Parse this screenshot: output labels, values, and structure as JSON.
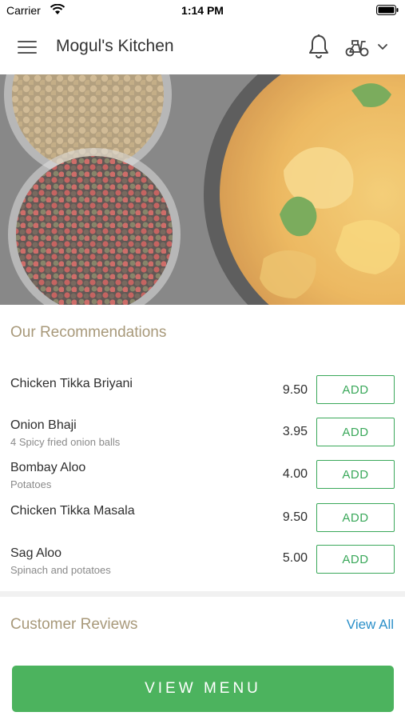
{
  "status_bar": {
    "carrier": "Carrier",
    "time": "1:14 PM"
  },
  "header": {
    "title": "Mogul's Kitchen"
  },
  "icons": [
    "menu-icon",
    "bell-icon",
    "delivery-scooter-icon",
    "chevron-down-icon",
    "wifi-icon",
    "battery-icon"
  ],
  "recommendations": {
    "title": "Our Recommendations",
    "add_label": "ADD",
    "items": [
      {
        "name": "Chicken Tikka Briyani",
        "description": "",
        "price": "9.50"
      },
      {
        "name": "Onion Bhaji",
        "description": "4 Spicy fried onion balls",
        "price": "3.95"
      },
      {
        "name": "Bombay Aloo",
        "description": "Potatoes",
        "price": "4.00"
      },
      {
        "name": "Chicken Tikka Masala",
        "description": "",
        "price": "9.50"
      },
      {
        "name": "Sag Aloo",
        "description": "Spinach and potatoes",
        "price": "5.00"
      }
    ]
  },
  "reviews": {
    "title": "Customer Reviews",
    "view_all": "View All"
  },
  "cta": {
    "view_menu": "VIEW MENU"
  },
  "colors": {
    "accent_green": "#4cb35e",
    "heading_tan": "#a8997a",
    "link_blue": "#2a8fc9"
  }
}
